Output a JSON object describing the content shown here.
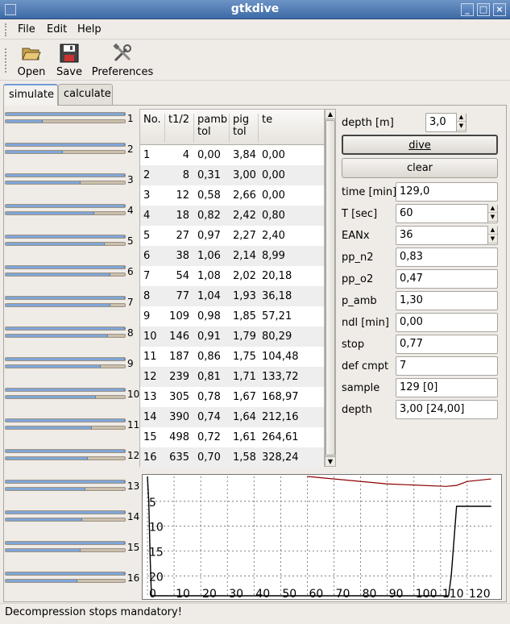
{
  "window": {
    "title": "gtkdive"
  },
  "menu": {
    "file": "File",
    "edit": "Edit",
    "help": "Help"
  },
  "toolbar": {
    "open": "Open",
    "save": "Save",
    "preferences": "Preferences"
  },
  "tabs": [
    "simulate",
    "calculate"
  ],
  "compartment_bars": [
    {
      "label": "1",
      "top": 1.0,
      "bottom": 0.31
    },
    {
      "label": "2",
      "top": 1.0,
      "bottom": 0.48
    },
    {
      "label": "3",
      "top": 1.0,
      "bottom": 0.63
    },
    {
      "label": "4",
      "top": 1.0,
      "bottom": 0.74
    },
    {
      "label": "5",
      "top": 1.0,
      "bottom": 0.83
    },
    {
      "label": "6",
      "top": 1.0,
      "bottom": 0.88
    },
    {
      "label": "7",
      "top": 1.0,
      "bottom": 0.88
    },
    {
      "label": "8",
      "top": 1.0,
      "bottom": 0.86
    },
    {
      "label": "9",
      "top": 1.0,
      "bottom": 0.8
    },
    {
      "label": "10",
      "top": 1.0,
      "bottom": 0.76
    },
    {
      "label": "11",
      "top": 1.0,
      "bottom": 0.72
    },
    {
      "label": "12",
      "top": 1.0,
      "bottom": 0.69
    },
    {
      "label": "13",
      "top": 1.0,
      "bottom": 0.67
    },
    {
      "label": "14",
      "top": 1.0,
      "bottom": 0.64
    },
    {
      "label": "15",
      "top": 1.0,
      "bottom": 0.63
    },
    {
      "label": "16",
      "top": 1.0,
      "bottom": 0.6
    }
  ],
  "table": {
    "headers": [
      "No.",
      "t1/2",
      "pamb\ntol",
      "pig\ntol",
      "te"
    ],
    "rows": [
      [
        "1",
        "4",
        "0,00",
        "3,84",
        "0,00"
      ],
      [
        "2",
        "8",
        "0,31",
        "3,00",
        "0,00"
      ],
      [
        "3",
        "12",
        "0,58",
        "2,66",
        "0,00"
      ],
      [
        "4",
        "18",
        "0,82",
        "2,42",
        "0,80"
      ],
      [
        "5",
        "27",
        "0,97",
        "2,27",
        "2,40"
      ],
      [
        "6",
        "38",
        "1,06",
        "2,14",
        "8,99"
      ],
      [
        "7",
        "54",
        "1,08",
        "2,02",
        "20,18"
      ],
      [
        "8",
        "77",
        "1,04",
        "1,93",
        "36,18"
      ],
      [
        "9",
        "109",
        "0,98",
        "1,85",
        "57,21"
      ],
      [
        "10",
        "146",
        "0,91",
        "1,79",
        "80,29"
      ],
      [
        "11",
        "187",
        "0,86",
        "1,75",
        "104,48"
      ],
      [
        "12",
        "239",
        "0,81",
        "1,71",
        "133,72"
      ],
      [
        "13",
        "305",
        "0,78",
        "1,67",
        "168,97"
      ],
      [
        "14",
        "390",
        "0,74",
        "1,64",
        "212,16"
      ],
      [
        "15",
        "498",
        "0,72",
        "1,61",
        "264,61"
      ],
      [
        "16",
        "635",
        "0,70",
        "1,58",
        "328,24"
      ]
    ]
  },
  "controls": {
    "depth_label": "depth [m]",
    "depth_value": "3,0",
    "dive_button": "dive",
    "clear_button": "clear"
  },
  "fields": [
    {
      "label": "time [min]",
      "value": "129,0"
    },
    {
      "label": "T [sec]",
      "value": "60",
      "spin": true
    },
    {
      "label": "EANx",
      "value": "36",
      "spin": true
    },
    {
      "label": "pp_n2",
      "value": "0,83"
    },
    {
      "label": "pp_o2",
      "value": "0,47"
    },
    {
      "label": "p_amb",
      "value": "1,30"
    },
    {
      "label": "ndl [min]",
      "value": "0,00"
    },
    {
      "label": "stop",
      "value": "0,77"
    },
    {
      "label": "def cmpt",
      "value": "7"
    },
    {
      "label": "sample",
      "value": "129 [0]"
    },
    {
      "label": "depth",
      "value": "3,00 [24,00]"
    }
  ],
  "graph": {
    "x_ticks": [
      "0",
      "10",
      "20",
      "30",
      "40",
      "50",
      "60",
      "70",
      "80",
      "90",
      "100",
      "110",
      "120"
    ],
    "y_ticks": [
      "5",
      "10",
      "15",
      "20"
    ],
    "x_max": 130,
    "y_max": 24,
    "depth_profile": [
      [
        0,
        0
      ],
      [
        0.5,
        5
      ],
      [
        1,
        16
      ],
      [
        1.5,
        24
      ],
      [
        113,
        24
      ],
      [
        114,
        20
      ],
      [
        116,
        6
      ],
      [
        118,
        6
      ],
      [
        129,
        6
      ]
    ],
    "ceiling_line": [
      [
        60,
        0
      ],
      [
        90,
        1.5
      ],
      [
        112,
        2
      ],
      [
        116,
        1.8
      ],
      [
        120,
        1
      ],
      [
        129,
        0.5
      ]
    ],
    "colors": {
      "depth": "#000000",
      "ceiling": "#8b0000",
      "grid": "#666666"
    }
  },
  "status": {
    "text": "Decompression stops mandatory!"
  }
}
